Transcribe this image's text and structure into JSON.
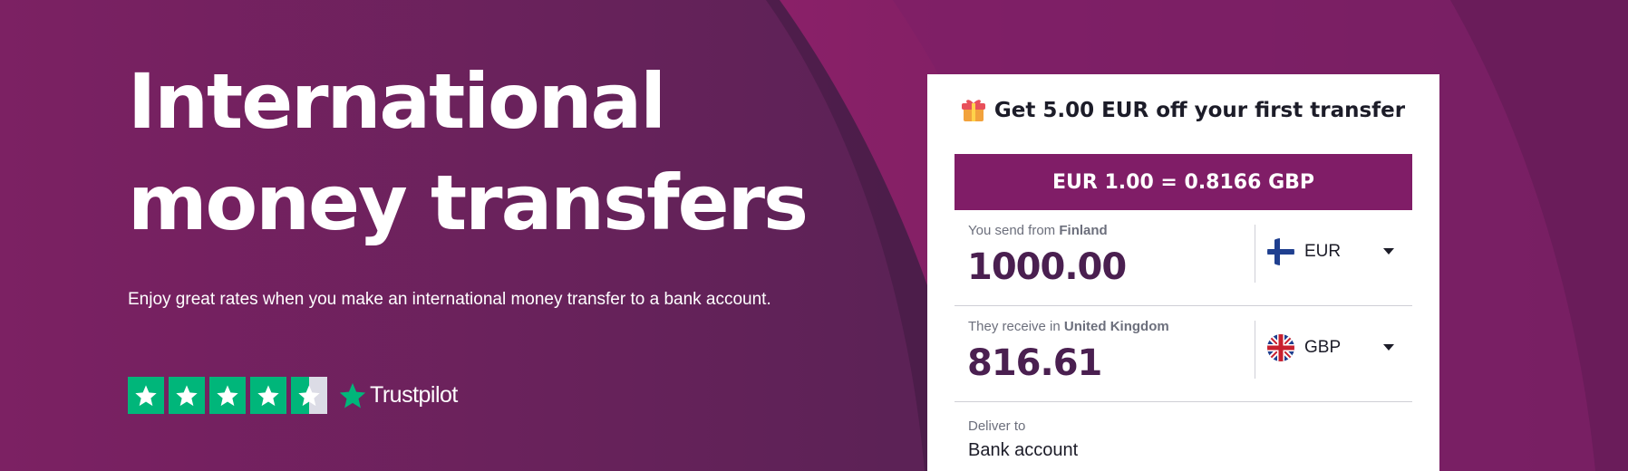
{
  "hero": {
    "title": "International\nmoney transfers",
    "subtitle": "Enjoy great rates when you make an international money transfer to a bank account.",
    "rating_stars": 4.5,
    "rating_max": 5,
    "trust_brand": "Trustpilot"
  },
  "calculator": {
    "promo_text": "Get 5.00 EUR off your first transfer",
    "exchange_rate_text": "EUR 1.00 = 0.8166 GBP",
    "send": {
      "label_prefix": "You send from",
      "country": "Finland",
      "amount": "1000.00",
      "currency": "EUR",
      "flag_icon": "finland-flag-icon"
    },
    "receive": {
      "label_prefix": "They receive in",
      "country": "United Kingdom",
      "amount": "816.61",
      "currency": "GBP",
      "flag_icon": "uk-flag-icon"
    },
    "deliver": {
      "label": "Deliver to",
      "value": "Bank account"
    }
  },
  "colors": {
    "brand_purple": "#801d67",
    "trustpilot_green": "#00b67a",
    "amount_text": "#4a1f50"
  }
}
